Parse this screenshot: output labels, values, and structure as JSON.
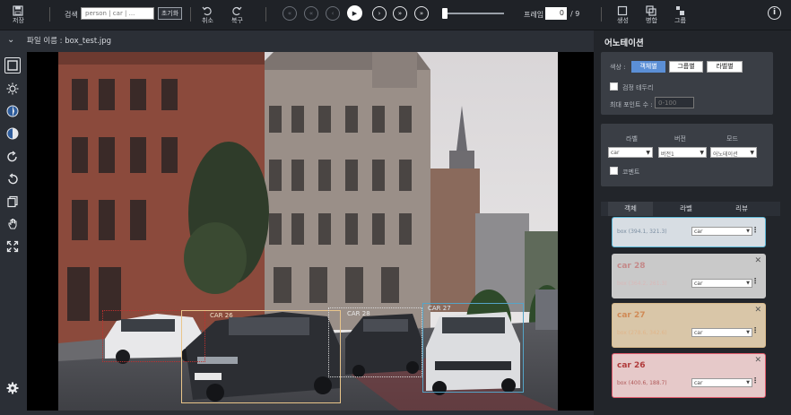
{
  "toolbar": {
    "save_label": "저장",
    "search_label": "검색",
    "search_placeholder": "person | car | ...",
    "reset_label": "초기화",
    "undo_label": "취소",
    "redo_label": "복구",
    "frame_label": "프레임",
    "frame_value": "0",
    "frame_total": "/ 9",
    "create_label": "생성",
    "merge_label": "병합",
    "group_label": "그룹",
    "info": "i"
  },
  "file": {
    "label": "파일 이름 : box_test.jpg"
  },
  "annotation": {
    "title": "어노테이션",
    "color_label": "색상 :",
    "color_options": [
      "객체별",
      "그룹별",
      "라벨별"
    ],
    "selected_color": "객체별",
    "border_label": "검정 테두리",
    "max_points_label": "최대 포인트 수 :",
    "max_points_placeholder": "0-100",
    "label_header": "라벨",
    "version_header": "버전",
    "mode_header": "모드",
    "label_value": "car",
    "version_value": "버전1",
    "mode_value": "어노테이션",
    "comment_label": "코멘트"
  },
  "tabs": [
    "객체",
    "라벨",
    "리뷰"
  ],
  "objects": [
    {
      "name": "",
      "coords": "box (394.1, 321.3)",
      "class": "car",
      "color": "#5bb6d6",
      "bg": "#d7dde3",
      "text_color": "#7a8da0"
    },
    {
      "name": "car 28",
      "coords": "box (364.2, 261.3)",
      "class": "car",
      "color": "#c9c9c9",
      "bg": "#c9c9c9",
      "text_color": "#c48989"
    },
    {
      "name": "car 27",
      "coords": "box (278.6, 342.6)",
      "class": "car",
      "color": "#d8b98a",
      "bg": "#d9c6a8",
      "text_color": "#d08a56"
    },
    {
      "name": "car 26",
      "coords": "box (400.6, 188.7)",
      "class": "car",
      "color": "#e05a6b",
      "bg": "#e6c9c9",
      "text_color": "#b03a3a"
    }
  ],
  "canvas_labels": {
    "car26": "CAR 26",
    "car27": "CAR 27",
    "car28": "CAR 28"
  },
  "colors": {
    "accent": "#5b8fd6",
    "panel": "#22252a",
    "background": "#2b2f36"
  }
}
